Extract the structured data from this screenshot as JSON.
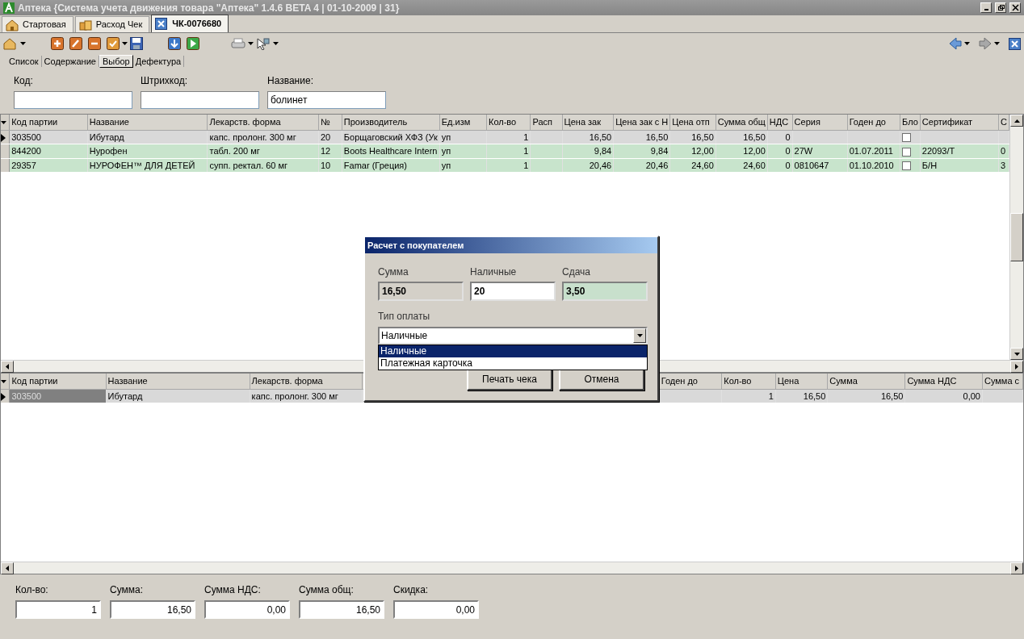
{
  "window": {
    "title": "Аптека {Система учета движения товара \"Аптека\" 1.4.6 BETA 4 | 01-10-2009 | 31}"
  },
  "tabs": [
    {
      "label": "Стартовая",
      "kind": "home",
      "selected": false
    },
    {
      "label": "Расход Чек",
      "kind": "boxes",
      "selected": false
    },
    {
      "label": "ЧК-0076680",
      "kind": "close",
      "selected": true
    }
  ],
  "sub_tabs": [
    {
      "label": "Список",
      "selected": false
    },
    {
      "label": "Содержание",
      "selected": false
    },
    {
      "label": "Выбор",
      "selected": true
    },
    {
      "label": "Дефектура",
      "selected": false
    }
  ],
  "search": [
    {
      "label": "Код:"
    },
    {
      "label": "Штрихкод:"
    },
    {
      "label": "Название:",
      "value": "болинет"
    }
  ],
  "goods_table": {
    "columns": [
      "Код партии",
      "Название",
      "Лекарств. форма",
      "№",
      "Производитель",
      "Ед.изм",
      "Кол-во",
      "Расп",
      "Цена зак",
      "Цена зак с Н",
      "Цена отп",
      "Сумма общ",
      "НДС",
      "Серия",
      "Годен до",
      "Бло",
      "Сертификат",
      "С"
    ],
    "rows": [
      {
        "selected": true,
        "blocked": false,
        "cells": [
          "303500",
          "Ибутард",
          "капс. пролонг. 300 мг",
          "20",
          "Борщаговский ХФЗ (Ук",
          "уп",
          "1",
          null,
          "16,50",
          "16,50",
          "16,50",
          "16,50",
          "0",
          null,
          null,
          null,
          null,
          null
        ]
      },
      {
        "selected": false,
        "blocked": false,
        "cells": [
          "844200",
          "Нурофен",
          "табл. 200 мг",
          "12",
          "Boots Healthcare Intern",
          "уп",
          "1",
          null,
          "9,84",
          "9,84",
          "12,00",
          "12,00",
          "0",
          "27W",
          "01.07.2011",
          null,
          "22093/Т",
          "0"
        ]
      },
      {
        "selected": false,
        "blocked": false,
        "cells": [
          "29357",
          "НУРОФЕН™ ДЛЯ ДЕТЕЙ",
          "супп. ректал. 60 мг",
          "10",
          "Famar (Греция)",
          "уп",
          "1",
          null,
          "20,46",
          "20,46",
          "24,60",
          "24,60",
          "0",
          "0810647",
          "01.10.2010",
          null,
          "Б/Н",
          "3"
        ]
      }
    ]
  },
  "receipt_table": {
    "columns": [
      "Код партии",
      "Название",
      "Лекарств. форма",
      null,
      null,
      null,
      "Годен до",
      "Кол-во",
      "Цена",
      "Сумма",
      "Сумма НДС",
      "Сумма с"
    ],
    "rows": [
      {
        "selected": true,
        "cells": [
          "303500",
          "Ибутард",
          "капс. пролонг. 300 мг",
          null,
          null,
          null,
          null,
          "1",
          "16,50",
          "16,50",
          "0,00",
          null
        ]
      }
    ]
  },
  "payment_dialog": {
    "title": "Расчет с покупателем",
    "fields": [
      {
        "label": "Сумма",
        "value": "16,50",
        "kind": "readonly"
      },
      {
        "label": "Наличные",
        "value": "20",
        "kind": "input"
      },
      {
        "label": "Сдача",
        "value": "3,50",
        "kind": "change"
      }
    ],
    "payment_type": {
      "label": "Тип оплаты",
      "value": "Наличные",
      "expanded": true,
      "options": [
        {
          "label": "Наличные",
          "selected": true
        },
        {
          "label": "Платежная карточка",
          "selected": false
        }
      ]
    },
    "buttons": [
      "Печать чека",
      "Отмена"
    ]
  },
  "totals": [
    {
      "label": "Кол-во:",
      "value": "1"
    },
    {
      "label": "Сумма:",
      "value": "16,50"
    },
    {
      "label": "Сумма НДС:",
      "value": "0,00"
    },
    {
      "label": "Сумма общ:",
      "value": "16,50"
    },
    {
      "label": "Скидка:",
      "value": "0,00"
    }
  ]
}
